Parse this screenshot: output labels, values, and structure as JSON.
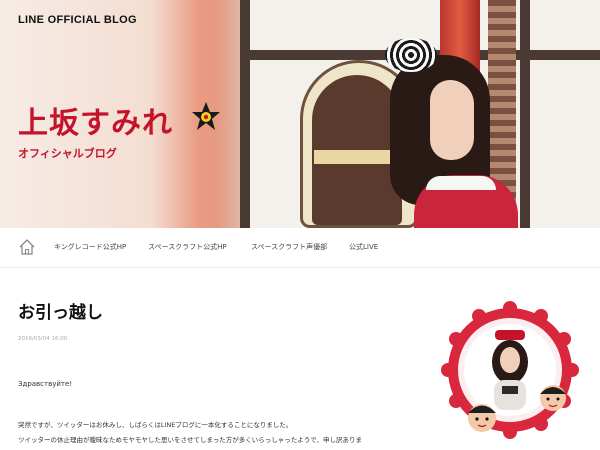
{
  "header": {
    "brand": "LINE OFFICIAL BLOG",
    "title": "上坂すみれ",
    "subtitle": "オフィシャルブログ"
  },
  "nav": {
    "items": [
      {
        "label": "キングレコード公式HP"
      },
      {
        "label": "スペースクラフト公式HP"
      },
      {
        "label": "スペースクラフト声優部"
      },
      {
        "label": "公式LIVE"
      }
    ]
  },
  "post": {
    "title": "お引っ越し",
    "date": "2016/03/04 16:00",
    "greeting": "Здравствуйте!",
    "line1": "突然ですが、ツイッターはお休みし、しばらくはLINEブログに一本化することになりました。",
    "line2": "ツイッターの休止理由が曖昧なためモヤモヤした思いをさせてしまった方が多くいらっしゃったようで、申し訳ありま"
  },
  "colors": {
    "accent": "#c5132a",
    "badge_ring": "#d9273d"
  },
  "icons": {
    "home": "home-icon",
    "star": "star-icon"
  }
}
